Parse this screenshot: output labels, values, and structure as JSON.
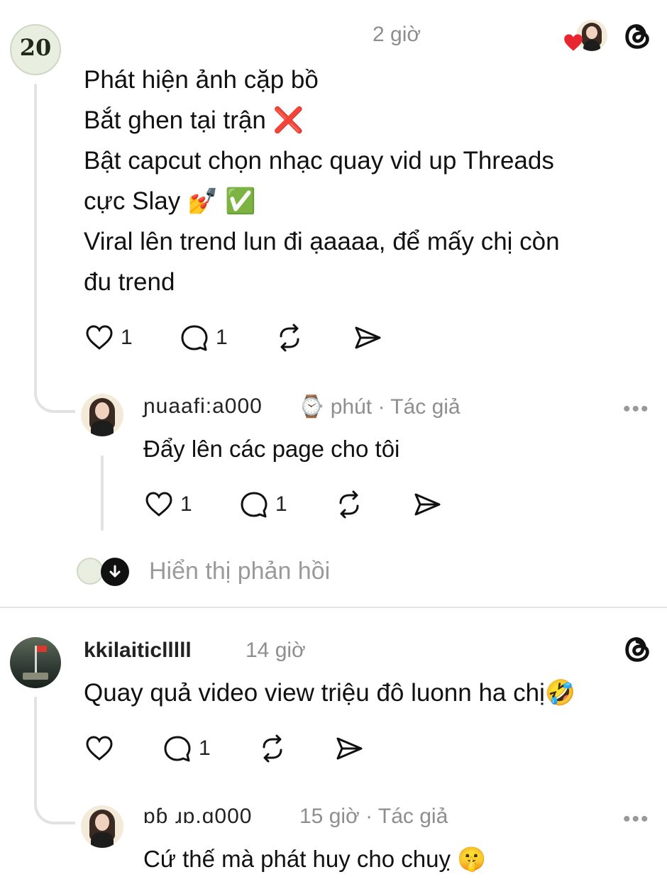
{
  "post1": {
    "username": "",
    "time": "2 giờ",
    "lines": [
      "Phát hiện ảnh cặp bồ",
      "Bắt ghen tại trận ❌",
      "Bật capcut chọn nhạc quay vid up Threads",
      "cực Slay 💅 ✅",
      "Viral lên trend lun đi ạaaaa, để mấy chị còn",
      "đu trend"
    ],
    "like_count": "1",
    "reply_count": "1",
    "avatar_text": "20"
  },
  "reply1": {
    "username": "ɲuaafi:a000",
    "time": "phút",
    "author_tag": "Tác giả",
    "text": "Đẩy lên các page cho tôi",
    "like_count": "1",
    "reply_count": "1",
    "more": "•••"
  },
  "show_replies": {
    "label": "Hiển thị phản hồi"
  },
  "post2": {
    "username": "kkilaiticlllll",
    "time": "14 giờ",
    "text": "Quay quả video view triệu đô luonn ha chị🤣",
    "reply_count": "1"
  },
  "reply2": {
    "username": "ɒɓ ɹɒ.ɑ000",
    "time": "15 giờ",
    "author_tag": "Tác giả",
    "text": "Cứ thế mà phát huy cho chuỵ 🤫",
    "more": "•••"
  },
  "colors": {
    "text": "#111111",
    "muted": "#8e8e8e",
    "line": "#e2e2e2",
    "heart": "#e8262f"
  }
}
